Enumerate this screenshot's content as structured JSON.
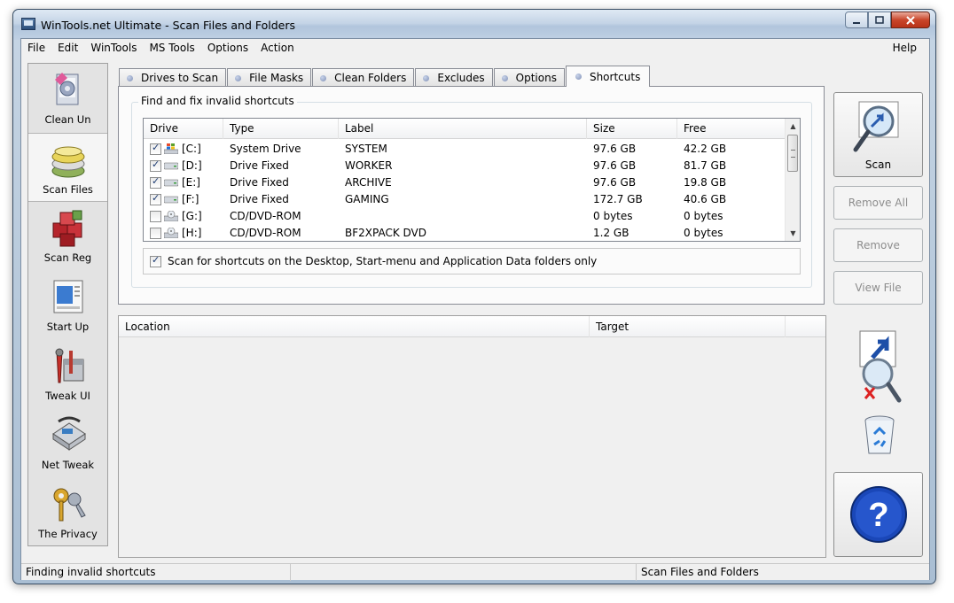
{
  "window": {
    "title": "WinTools.net Ultimate - Scan Files and Folders"
  },
  "menu": {
    "items": [
      "File",
      "Edit",
      "WinTools",
      "MS Tools",
      "Options",
      "Action"
    ],
    "help": "Help"
  },
  "sidebar": {
    "items": [
      {
        "label": "Clean Un",
        "icon": "clean-uninstaller-icon",
        "active": false
      },
      {
        "label": "Scan Files",
        "icon": "scan-files-icon",
        "active": true
      },
      {
        "label": "Scan Reg",
        "icon": "scan-registry-icon",
        "active": false
      },
      {
        "label": "Start Up",
        "icon": "startup-icon",
        "active": false
      },
      {
        "label": "Tweak UI",
        "icon": "tweak-ui-icon",
        "active": false
      },
      {
        "label": "Net Tweak",
        "icon": "net-tweak-icon",
        "active": false
      },
      {
        "label": "The Privacy",
        "icon": "privacy-keys-icon",
        "active": false
      }
    ]
  },
  "tabs": [
    {
      "label": "Drives to Scan",
      "active": false
    },
    {
      "label": "File Masks",
      "active": false
    },
    {
      "label": "Clean Folders",
      "active": false
    },
    {
      "label": "Excludes",
      "active": false
    },
    {
      "label": "Options",
      "active": false
    },
    {
      "label": "Shortcuts",
      "active": true
    }
  ],
  "shortcuts": {
    "group_title": "Find and fix invalid shortcuts",
    "columns": [
      "Drive",
      "Type",
      "Label",
      "Size",
      "Free"
    ],
    "drives": [
      {
        "checked": true,
        "drive": "[C:]",
        "type": "System Drive",
        "label": "SYSTEM",
        "size": "97.6 GB",
        "free": "42.2 GB",
        "icon": "windows-drive-icon"
      },
      {
        "checked": true,
        "drive": "[D:]",
        "type": "Drive Fixed",
        "label": "WORKER",
        "size": "97.6 GB",
        "free": "81.7 GB",
        "icon": "hard-drive-icon"
      },
      {
        "checked": true,
        "drive": "[E:]",
        "type": "Drive Fixed",
        "label": "ARCHIVE",
        "size": "97.6 GB",
        "free": "19.8 GB",
        "icon": "hard-drive-icon"
      },
      {
        "checked": true,
        "drive": "[F:]",
        "type": "Drive Fixed",
        "label": "GAMING",
        "size": "172.7 GB",
        "free": "40.6 GB",
        "icon": "hard-drive-icon"
      },
      {
        "checked": false,
        "drive": "[G:]",
        "type": "CD/DVD-ROM",
        "label": "",
        "size": "0 bytes",
        "free": "0 bytes",
        "icon": "cd-drive-icon"
      },
      {
        "checked": false,
        "drive": "[H:]",
        "type": "CD/DVD-ROM",
        "label": "BF2XPACK DVD",
        "size": "1.2 GB",
        "free": "0 bytes",
        "icon": "cd-drive-icon"
      }
    ],
    "option_label": "Scan for shortcuts on the Desktop, Start-menu and Application Data folders only",
    "option_checked": true
  },
  "results": {
    "columns": [
      "Location",
      "Target"
    ]
  },
  "actions": {
    "scan": "Scan",
    "remove_all": "Remove All",
    "remove": "Remove",
    "view_file": "View File"
  },
  "status": {
    "left": "Finding invalid shortcuts",
    "middle": "",
    "right": "Scan Files and Folders"
  },
  "colors": {
    "accent": "#2a5db0",
    "disabled_text": "#8d8d8d"
  }
}
